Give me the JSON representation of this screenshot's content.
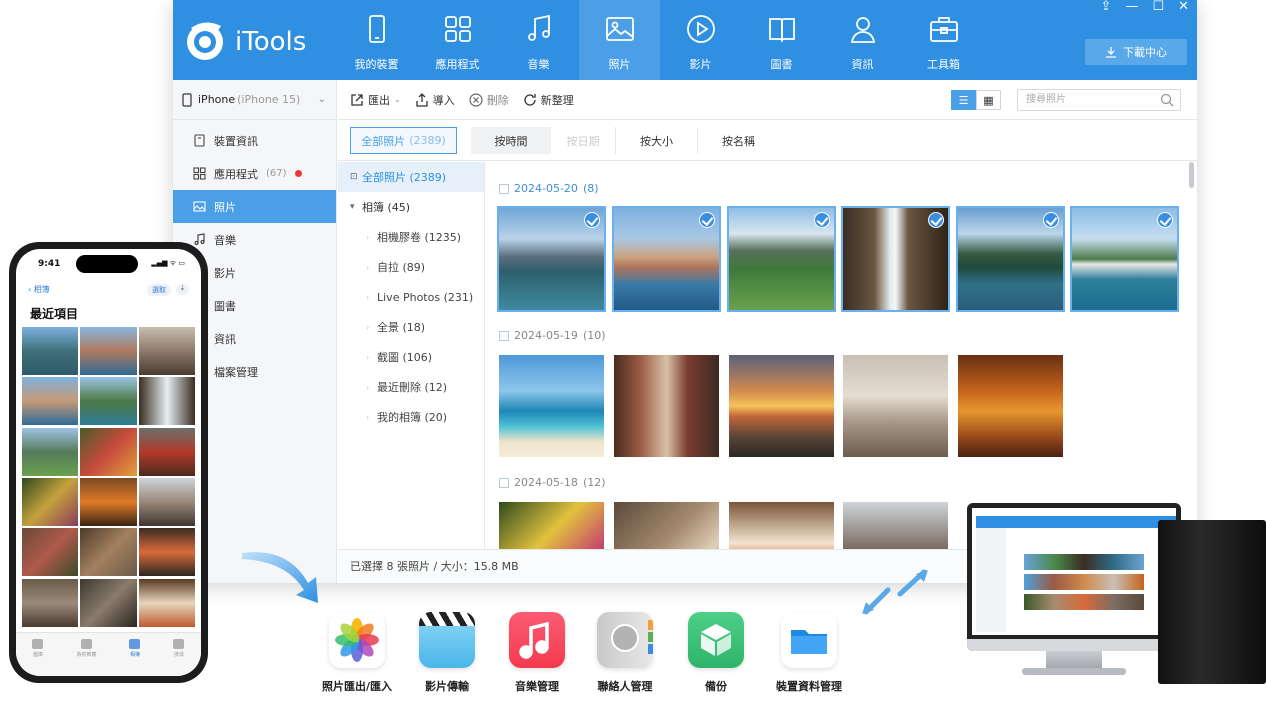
{
  "app": {
    "brand": "iTools",
    "nav": [
      {
        "label": "我的裝置",
        "icon": "phone-icon"
      },
      {
        "label": "應用程式",
        "icon": "apps-icon"
      },
      {
        "label": "音樂",
        "icon": "music-icon"
      },
      {
        "label": "照片",
        "icon": "photo-icon",
        "active": true
      },
      {
        "label": "影片",
        "icon": "play-icon"
      },
      {
        "label": "圖書",
        "icon": "book-icon"
      },
      {
        "label": "資訊",
        "icon": "contact-icon"
      },
      {
        "label": "工具箱",
        "icon": "toolbox-icon"
      }
    ],
    "window_controls": [
      "⇪",
      "—",
      "☐",
      "✕"
    ],
    "download_center": "下載中心",
    "device": {
      "name": "iPhone",
      "model": "(iPhone 15)"
    },
    "sidebar": [
      {
        "label": "裝置資訊",
        "icon": "device-info-icon",
        "count": ""
      },
      {
        "label": "應用程式",
        "icon": "apps-icon",
        "count": "(67)",
        "badge": true
      },
      {
        "label": "照片",
        "icon": "photo-icon",
        "count": "",
        "active": true
      },
      {
        "label": "音樂",
        "icon": "music-icon",
        "count": ""
      },
      {
        "label": "影片",
        "icon": "video-icon",
        "count": ""
      },
      {
        "label": "圖書",
        "icon": "book-icon",
        "count": ""
      },
      {
        "label": "資訊",
        "icon": "info-icon",
        "count": ""
      },
      {
        "label": "檔案管理",
        "icon": "folder-icon",
        "count": ""
      }
    ],
    "toolbar": {
      "export": "匯出",
      "import": "導入",
      "delete": "刪除",
      "refresh": "新整理",
      "search_placeholder": "搜尋照片"
    },
    "filters": {
      "all": "全部照片",
      "all_count": "(2389)",
      "by_time": "按時間",
      "by_day": "按日期",
      "by_size": "按大小",
      "by_name": "按名稱"
    },
    "tree": {
      "all": "全部照片 (2389)",
      "albums": "相簿 (45)",
      "children": [
        "相機膠卷 (1235)",
        "自拉 (89)",
        "Live Photos (231)",
        "全景 (18)",
        "截圖 (106)",
        "最近刪除 (12)",
        "我的相簿 (20)"
      ]
    },
    "groups": [
      {
        "date": "2024-05-20",
        "count": "(8)"
      },
      {
        "date": "2024-05-19",
        "count": "(10)"
      },
      {
        "date": "2024-05-18",
        "count": "(12)"
      }
    ],
    "status": "已選擇 8 張照片 / 大小：15.8 MB",
    "colors": {
      "primary": "#2f8fe0",
      "active_nav": "#4a9fe6",
      "check": "#3c8ee2"
    }
  },
  "phone": {
    "time": "9:41",
    "status": "▂▄▆ ᯤ ▭",
    "back": "相簿",
    "select": "選取",
    "title": "最近項目",
    "tabs": [
      {
        "label": "圖庫"
      },
      {
        "label": "為你推薦"
      },
      {
        "label": "相簿",
        "active": true
      },
      {
        "label": "搜尋"
      }
    ]
  },
  "features": [
    {
      "label": "照片匯出/匯入",
      "icon": "photos-app-icon"
    },
    {
      "label": "影片傳輸",
      "icon": "clapperboard-icon"
    },
    {
      "label": "音樂管理",
      "icon": "music-app-icon"
    },
    {
      "label": "聯絡人管理",
      "icon": "contacts-app-icon"
    },
    {
      "label": "備份",
      "icon": "backup-box-icon"
    },
    {
      "label": "裝置資料管理",
      "icon": "folder-app-icon"
    }
  ]
}
